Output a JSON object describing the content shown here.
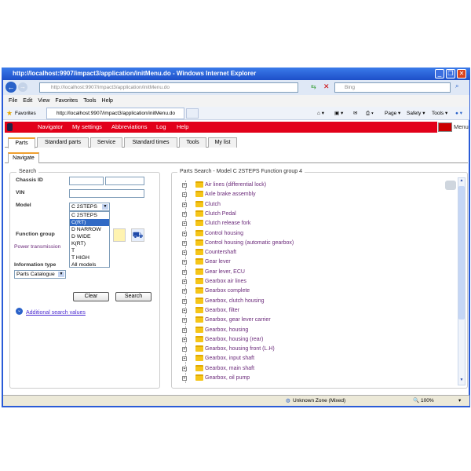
{
  "window": {
    "title": "http://localhost:9907/impact3/application/initMenu.do - Windows Internet Explorer"
  },
  "address": {
    "url": "http://localhost:9907/impact3/application/initMenu.do",
    "search_placeholder": "Bing"
  },
  "menubar": [
    "File",
    "Edit",
    "View",
    "Favorites",
    "Tools",
    "Help"
  ],
  "favbar": {
    "favorites": "Favorites",
    "tab": "http://localhost:9907/impact3/application/initMenu.do",
    "page": "Page",
    "safety": "Safety",
    "tools": "Tools"
  },
  "nav": {
    "items": [
      "Navigator",
      "My settings",
      "Abbreviations",
      "Log",
      "Help"
    ],
    "menu": "Menu"
  },
  "tabs": [
    "Parts",
    "Standard parts",
    "Service",
    "Standard times",
    "Tools",
    "My list"
  ],
  "subtab": "Navigate",
  "search": {
    "legend": "Search",
    "chassis_id": "Chassis ID",
    "vin": "VIN",
    "model": "Model",
    "model_value": "C 2STEPS",
    "model_options": [
      "C 2STEPS",
      "C(RT)",
      "D NARROW",
      "D WIDE",
      "K(RT)",
      "T",
      "T HIGH",
      "All models"
    ],
    "highlighted_option": "C(RT)",
    "function_group": "Function group",
    "power_transmission": "Power transmission",
    "information_type": "Information type",
    "information_value": "Parts Catalogue",
    "clear": "Clear",
    "search": "Search",
    "additional": "Additional search values"
  },
  "results": {
    "legend": "Parts Search - Model C 2STEPS Function group 4",
    "items": [
      "Air lines (differential lock)",
      "Axle brake assembly",
      "Clutch",
      "Clutch Pedal",
      "Clutch release fork",
      "Control housing",
      "Control housing (automatic gearbox)",
      "Countershaft",
      "Gear lever",
      "Gear lever, ECU",
      "Gearbox air lines",
      "Gearbox complete",
      "Gearbox, clutch housing",
      "Gearbox, filter",
      "Gearbox, gear lever carrier",
      "Gearbox, housing",
      "Gearbox, housing (rear)",
      "Gearbox, housing front (L.H)",
      "Gearbox, input shaft",
      "Gearbox, main shaft",
      "Gearbox, oil pump"
    ]
  },
  "status": {
    "zone": "Unknown Zone (Mixed)",
    "zoom": "100%"
  },
  "colors": {
    "nav_red": "#e2001a",
    "link_purple": "#6b2a7a",
    "title_blue": "#1d4fc9"
  }
}
